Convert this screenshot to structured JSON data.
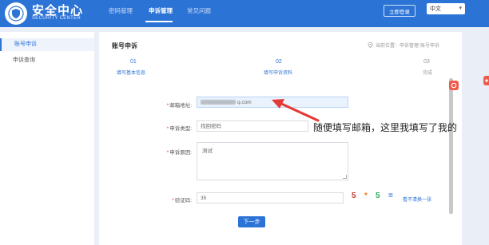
{
  "header": {
    "brand_cn": "安全中心",
    "brand_en": "SECURITY CENTER",
    "nav": [
      "密码管理",
      "申诉管理",
      "常见问题"
    ],
    "login_label": "立即登录",
    "language": "中文"
  },
  "sidebar": {
    "items": [
      {
        "label": "账号申诉",
        "active": true
      },
      {
        "label": "申诉查询",
        "active": false
      }
    ]
  },
  "main": {
    "title": "账号申诉",
    "location": "当前位置：申诉管理·账号申诉",
    "steps": [
      {
        "num": "01",
        "label": "填写基本信息"
      },
      {
        "num": "02",
        "label": "填写申诉资料"
      },
      {
        "num": "03",
        "label": "完成"
      }
    ],
    "form": {
      "email_label": "邮箱地址:",
      "email_value": "q.com",
      "type_label": "申诉类型:",
      "type_value": "找回密码",
      "reason_label": "申诉原因:",
      "reason_value": "测试",
      "code_label": "验证码:",
      "code_value": "35",
      "captcha": [
        "5",
        "*",
        "5",
        "="
      ],
      "refresh": "看不清换一张",
      "submit": "下一步"
    }
  },
  "annotation": "随便填写邮箱，这里我填写了我的",
  "colors": {
    "accent": "#2c73d6",
    "arrow": "#e53935"
  }
}
